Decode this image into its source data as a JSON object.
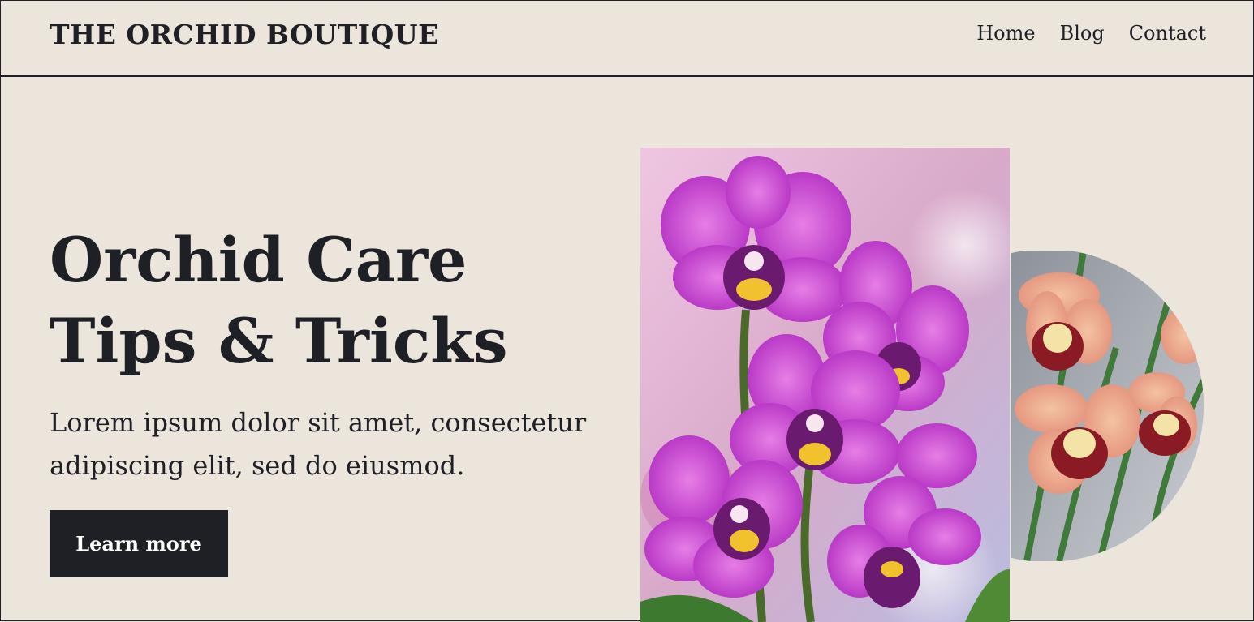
{
  "header": {
    "brand": "THE ORCHID BOUTIQUE",
    "nav": [
      "Home",
      "Blog",
      "Contact"
    ]
  },
  "hero": {
    "title_line1": "Orchid Care",
    "title_line2": "Tips & Tricks",
    "description": "Lorem ipsum dolor sit amet, consectetur adipiscing elit, sed do eiusmod.",
    "cta_label": "Learn more"
  },
  "images": {
    "main_photo": "purple-orchid-photo",
    "circle_photo": "peach-orchid-photo"
  },
  "colors": {
    "background": "#ece5dc",
    "text": "#1f2026",
    "button": "#1f2026",
    "button_text": "#ffffff"
  }
}
